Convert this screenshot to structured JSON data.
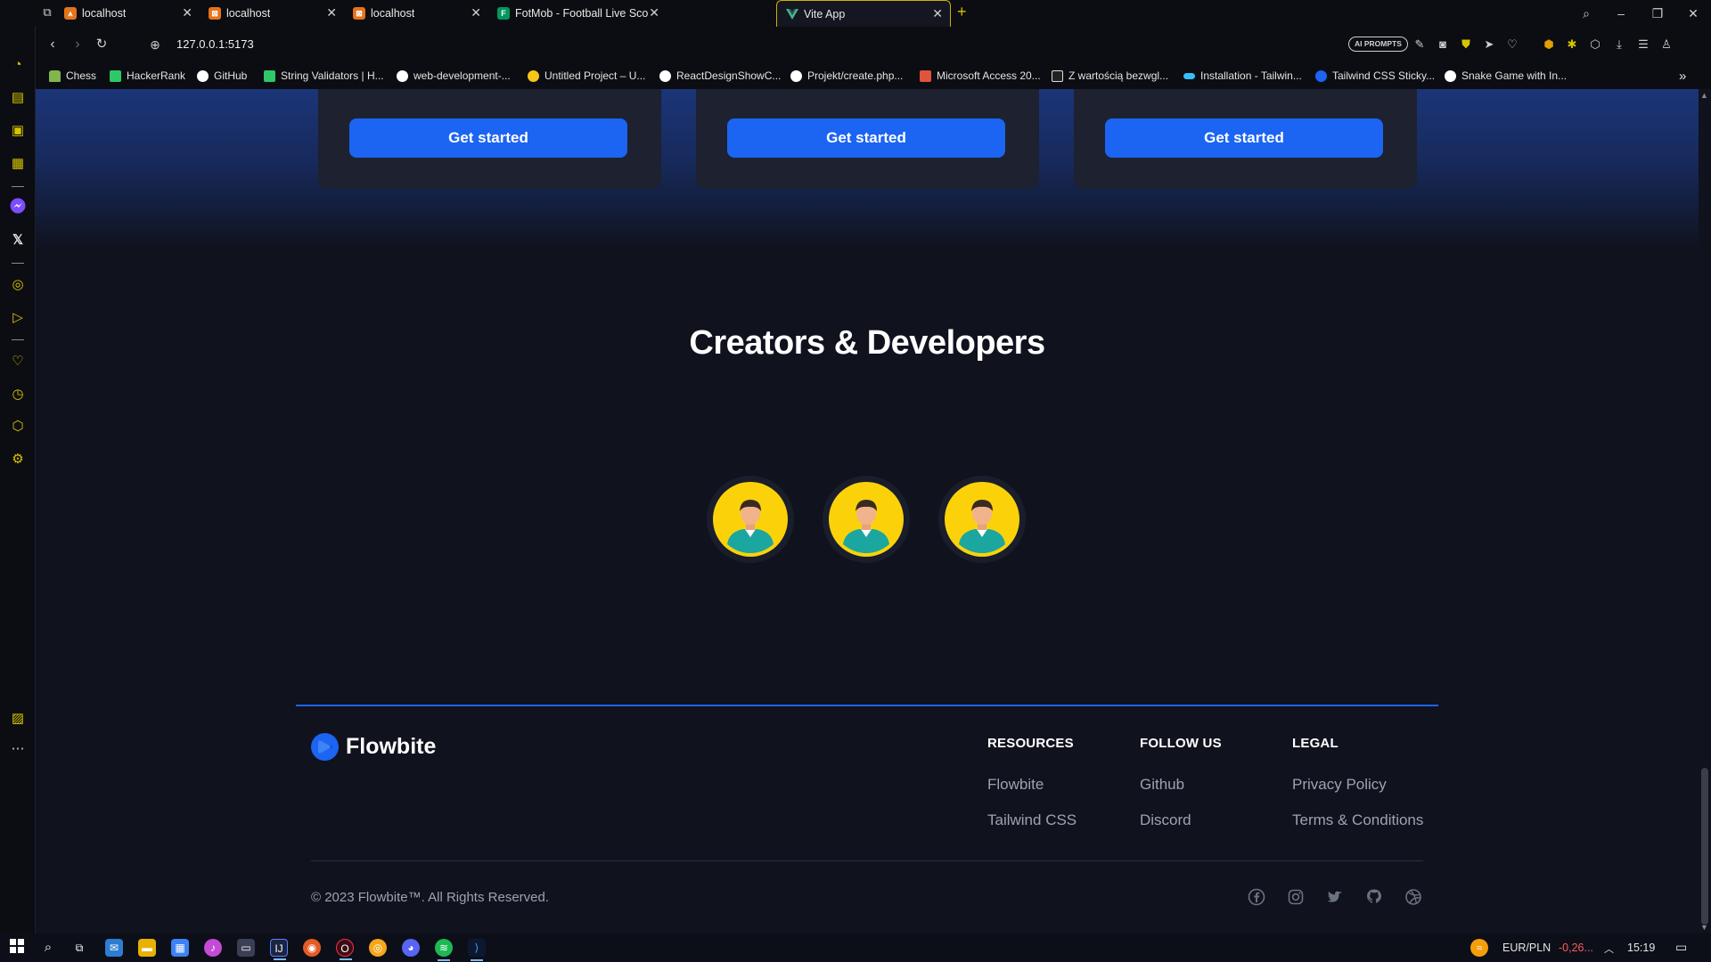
{
  "browser": {
    "tabs": [
      {
        "title": "localhost",
        "favicon": "xampp-icon",
        "color": "#e5731b",
        "active": false
      },
      {
        "title": "localhost",
        "favicon": "xampp-icon",
        "color": "#e5731b",
        "active": false
      },
      {
        "title": "localhost",
        "favicon": "xampp-icon",
        "color": "#e5731b",
        "active": false
      },
      {
        "title": "FotMob - Football Live Sco",
        "favicon": "fotmob-icon",
        "color": "#00985f",
        "active": false
      },
      {
        "title": "Vite App",
        "favicon": "vue-icon",
        "color": "#41b883",
        "active": true
      }
    ],
    "new_tab_label": "+",
    "url": "127.0.0.1:5173",
    "ai_prompts_label": "AI PROMPTS",
    "bookmarks": [
      {
        "label": "Chess",
        "icon": "chess-pawn-icon",
        "color": "#81b64c"
      },
      {
        "label": "HackerRank",
        "icon": "hackerrank-icon",
        "color": "#2ec866"
      },
      {
        "label": "GitHub",
        "icon": "github-icon",
        "color": "#ffffff"
      },
      {
        "label": "String Validators | H...",
        "icon": "hackerrank-icon",
        "color": "#2ec866"
      },
      {
        "label": "web-development-...",
        "icon": "github-icon",
        "color": "#ffffff"
      },
      {
        "label": "Untitled Project – U...",
        "icon": "smiley-icon",
        "color": "#f5c518"
      },
      {
        "label": "ReactDesignShowC...",
        "icon": "github-icon",
        "color": "#ffffff"
      },
      {
        "label": "Projekt/create.php...",
        "icon": "github-icon",
        "color": "#ffffff"
      },
      {
        "label": "Microsoft Access 20...",
        "icon": "access-icon",
        "color": "#e0533c"
      },
      {
        "label": "Z wartością bezwgl...",
        "icon": "sigma-icon",
        "color": "#dddddd"
      },
      {
        "label": "Installation - Tailwin...",
        "icon": "tailwind-icon",
        "color": "#38bdf8"
      },
      {
        "label": "Tailwind CSS Sticky...",
        "icon": "flowbite-icon",
        "color": "#1c64f2"
      },
      {
        "label": "Snake Game with In...",
        "icon": "github-icon",
        "color": "#ffffff"
      }
    ],
    "bookmarks_overflow": "»"
  },
  "page": {
    "pricing_cta": [
      "Get started",
      "Get started",
      "Get started"
    ],
    "creators_title": "Creators & Developers",
    "avatars": [
      "developer-avatar",
      "developer-avatar",
      "developer-avatar"
    ],
    "footer": {
      "brand": "Flowbite",
      "columns": [
        {
          "heading": "RESOURCES",
          "links": [
            "Flowbite",
            "Tailwind CSS"
          ]
        },
        {
          "heading": "FOLLOW US",
          "links": [
            "Github",
            "Discord"
          ]
        },
        {
          "heading": "LEGAL",
          "links": [
            "Privacy Policy",
            "Terms & Conditions"
          ]
        }
      ],
      "copyright": "© 2023 Flowbite™. All Rights Reserved.",
      "social_icons": [
        "facebook-icon",
        "instagram-icon",
        "twitter-icon",
        "github-icon",
        "dribbble-icon"
      ]
    }
  },
  "taskbar": {
    "currency_pair": "EUR/PLN",
    "currency_change": "-0,26...",
    "clock": "15:19"
  },
  "colors": {
    "accent": "#1c64f2",
    "page_bg": "#10121e",
    "browser_accent": "#d6c400"
  }
}
